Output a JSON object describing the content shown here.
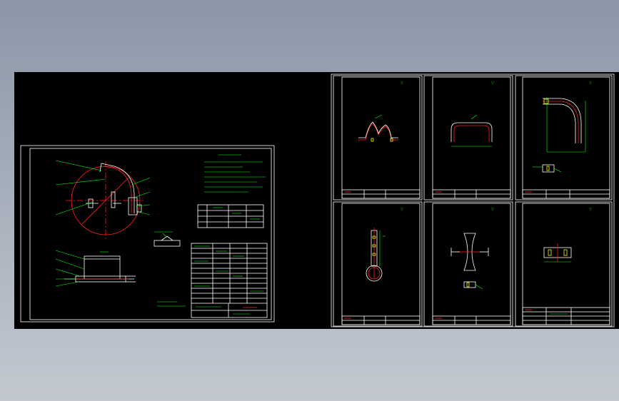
{
  "viewport": {
    "background_top": "#8b97a8",
    "background_bottom": "#c3c8d0",
    "canvas_color": "#000000"
  },
  "colors": {
    "frame": "#ffffff",
    "annotation": "#00ff00",
    "part_outline": "#ff2020",
    "centerline": "#ff2020",
    "highlight": "#ffff00"
  },
  "drawing_sheets": [
    {
      "id": "main-assembly",
      "kind": "assembly"
    },
    {
      "id": "part-1",
      "kind": "part"
    },
    {
      "id": "part-2",
      "kind": "part"
    },
    {
      "id": "part-3",
      "kind": "part"
    },
    {
      "id": "part-4",
      "kind": "part"
    },
    {
      "id": "part-5",
      "kind": "part"
    },
    {
      "id": "part-6",
      "kind": "part"
    }
  ],
  "icons": [
    "surface-finish-symbol-icon",
    "title-block-icon"
  ]
}
